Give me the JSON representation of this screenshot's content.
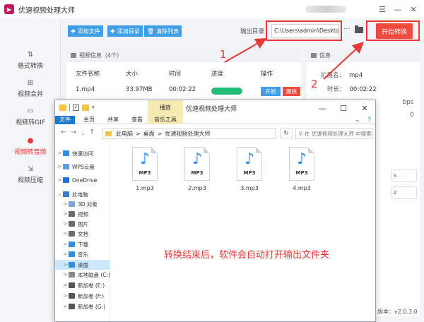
{
  "app": {
    "title": "优速视频处理大师",
    "logo": "▶",
    "window_controls": [
      "☰",
      "—",
      "✕"
    ]
  },
  "sidebar": {
    "items": [
      {
        "icon": "⇅",
        "label": "格式转换"
      },
      {
        "icon": "⊞",
        "label": "视频合并"
      },
      {
        "icon": "▭",
        "label": "视频转GIF"
      },
      {
        "icon": "●",
        "label": "视频转音频",
        "active": true
      },
      {
        "icon": "⇲",
        "label": "视频压缩"
      }
    ]
  },
  "toolbar": {
    "add_file": "添加文件",
    "add_folder": "添加目录",
    "clear_list": "清除列表",
    "output_label": "输出目录",
    "output_path": "C:\\Users\\admin\\Deskto",
    "more": "···",
    "convert_button": "开始转换"
  },
  "file_panel": {
    "header": "视频信息（4个）",
    "columns": [
      "文件名称",
      "大小",
      "时间",
      "进度",
      "操作"
    ],
    "rows": [
      {
        "name": "1.mp4",
        "size": "33.97MB",
        "time": "00:02:22",
        "progress": 1.0,
        "start": "开始",
        "delete": "删除"
      }
    ]
  },
  "info_panel": {
    "header": "信息",
    "ext_label": "扩展名：",
    "ext_value": "mp4",
    "duration_label": "时长：",
    "duration_value": "00:02:22",
    "bitrate_fragment": "bps",
    "fragment_0": "0",
    "select_1": "s",
    "select_2": "z",
    "version": "版本：v2.0.3.0"
  },
  "annotations": {
    "num1": "1",
    "num2": "2",
    "caption": "转换结束后，软件会自动打开输出文件夹",
    "color": "#e53935"
  },
  "explorer": {
    "title": "优速视频处理大师",
    "manage_tab": "播放",
    "ribbon_tabs": [
      "文件",
      "主页",
      "共享",
      "查看",
      "音乐工具"
    ],
    "ribbon_expand": "⌄",
    "help": "?",
    "controls": [
      "—",
      "☐",
      "✕"
    ],
    "address": [
      "此电脑",
      ">",
      "桌面",
      ">",
      "优速视频处理大师"
    ],
    "search_placeholder": "在 优速视频处理大师 中搜索",
    "nav": [
      {
        "label": "快速访问",
        "icon_color": "#2f8ee3",
        "chev": ">"
      },
      {
        "label": "WPS云盘",
        "icon_color": "#5c9ded",
        "chev": ">"
      },
      {
        "label": "OneDrive",
        "icon_color": "#1e73d6",
        "chev": ">"
      },
      {
        "label": "此电脑",
        "icon_color": "#3a7bd5",
        "chev": "⌄"
      },
      {
        "label": "3D 对象",
        "icon_color": "#7aa7d8",
        "chev": ">"
      },
      {
        "label": "视频",
        "icon_color": "#6b6b6b",
        "chev": ">"
      },
      {
        "label": "图片",
        "icon_color": "#6b6b6b",
        "chev": ">"
      },
      {
        "label": "文档",
        "icon_color": "#6b6b6b",
        "chev": ">"
      },
      {
        "label": "下载",
        "icon_color": "#2f8ee3",
        "chev": ">"
      },
      {
        "label": "音乐",
        "icon_color": "#2f8ee3",
        "chev": ">"
      },
      {
        "label": "桌面",
        "icon_color": "#2f8ee3",
        "chev": ">",
        "selected": true
      },
      {
        "label": "本地磁盘 (C:)",
        "icon_color": "#8a8a8a",
        "chev": ">"
      },
      {
        "label": "新加卷 (E:)",
        "icon_color": "#555555",
        "chev": ">"
      },
      {
        "label": "新加卷 (F:)",
        "icon_color": "#555555",
        "chev": ">"
      },
      {
        "label": "新加卷 (G:)",
        "icon_color": "#555555",
        "chev": ">"
      }
    ],
    "files": [
      {
        "name": "1.mp3",
        "badge": "MP3"
      },
      {
        "name": "2.mp3",
        "badge": "MP3"
      },
      {
        "name": "3.mp3",
        "badge": "MP3"
      },
      {
        "name": "4.mp3",
        "badge": "MP3"
      }
    ]
  }
}
